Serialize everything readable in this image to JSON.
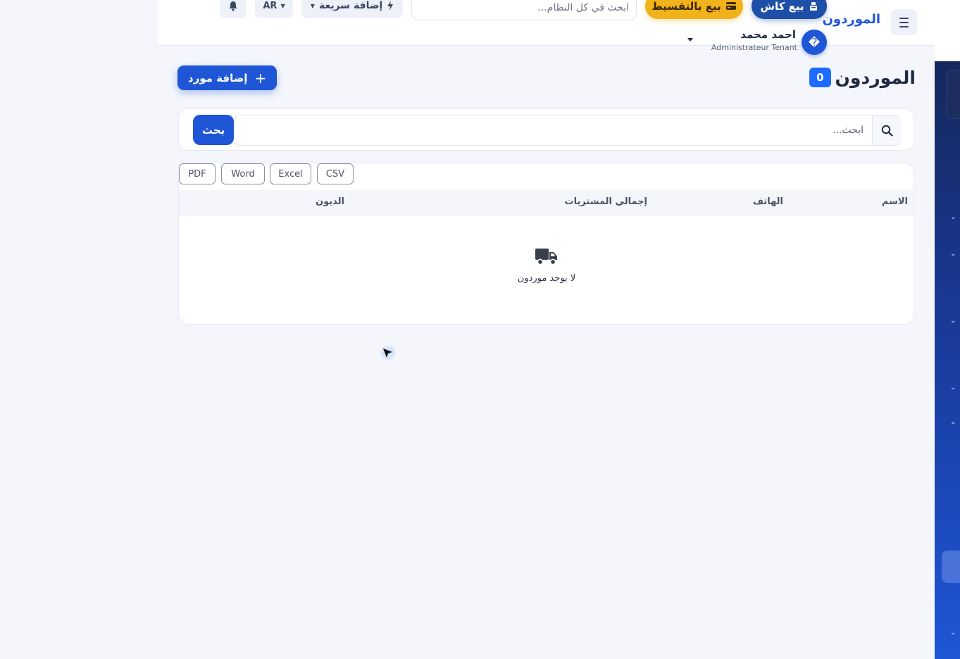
{
  "header": {
    "brand": "الموردون",
    "cash_sale": "بيع كاش",
    "installment_sale": "بيع بالتقسيط",
    "global_search_placeholder": "ابحث في كل النظام...",
    "quick_add": "إضافة سريعة",
    "language": "AR",
    "user": {
      "name": "احمد محمد",
      "role": "Administrateur Tenant",
      "avatar_glyph": "�"
    }
  },
  "page": {
    "title": "الموردون",
    "count": "0",
    "add_button": "إضافة مورد"
  },
  "search": {
    "placeholder": "ابحث...",
    "button": "بحث"
  },
  "export": {
    "csv": "CSV",
    "excel": "Excel",
    "word": "Word",
    "pdf": "PDF"
  },
  "table": {
    "columns": {
      "name": "الاسم",
      "phone": "الهاتف",
      "total_purchases": "إجمالي المشتريات",
      "debts": "الديون"
    },
    "empty_message": "لا يوجد موردون",
    "empty_icon": "truck-icon"
  },
  "colors": {
    "primary": "#1e56d6",
    "cash_button": "#1e4fa8",
    "installment_button": "#f2b21c",
    "badge": "#1e6bff",
    "background": "#f4f6fb"
  }
}
